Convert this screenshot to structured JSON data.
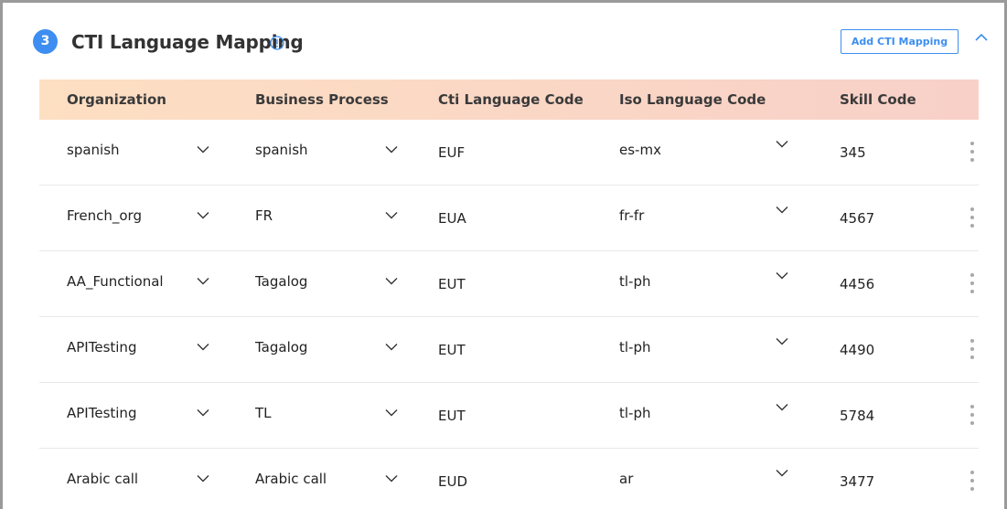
{
  "section": {
    "step_number": "3",
    "title": "CTI Language Mapping",
    "add_button_label": "Add CTI Mapping"
  },
  "colors": {
    "accent": "#3d8ef0",
    "header_gradient_start": "#fddfc2",
    "header_gradient_end": "#f8d0c8"
  },
  "icons": {
    "info": "info-icon",
    "collapse": "chevron-up-icon",
    "dropdown": "chevron-down-icon",
    "row_menu": "kebab-menu-icon"
  },
  "table": {
    "columns": [
      "Organization",
      "Business Process",
      "Cti Language Code",
      "Iso Language Code",
      "Skill Code"
    ],
    "rows": [
      {
        "organization": "spanish",
        "business_process": "spanish",
        "cti_code": "EUF",
        "iso_code": "es-mx",
        "skill_code": "345"
      },
      {
        "organization": "French_org",
        "business_process": "FR",
        "cti_code": "EUA",
        "iso_code": "fr-fr",
        "skill_code": "4567"
      },
      {
        "organization": "AA_Functional",
        "business_process": "Tagalog",
        "cti_code": "EUT",
        "iso_code": "tl-ph",
        "skill_code": "4456"
      },
      {
        "organization": "APITesting",
        "business_process": "Tagalog",
        "cti_code": "EUT",
        "iso_code": "tl-ph",
        "skill_code": "4490"
      },
      {
        "organization": "APITesting",
        "business_process": "TL",
        "cti_code": "EUT",
        "iso_code": "tl-ph",
        "skill_code": "5784"
      },
      {
        "organization": "Arabic call",
        "business_process": "Arabic call",
        "cti_code": "EUD",
        "iso_code": "ar",
        "skill_code": "3477"
      }
    ]
  }
}
